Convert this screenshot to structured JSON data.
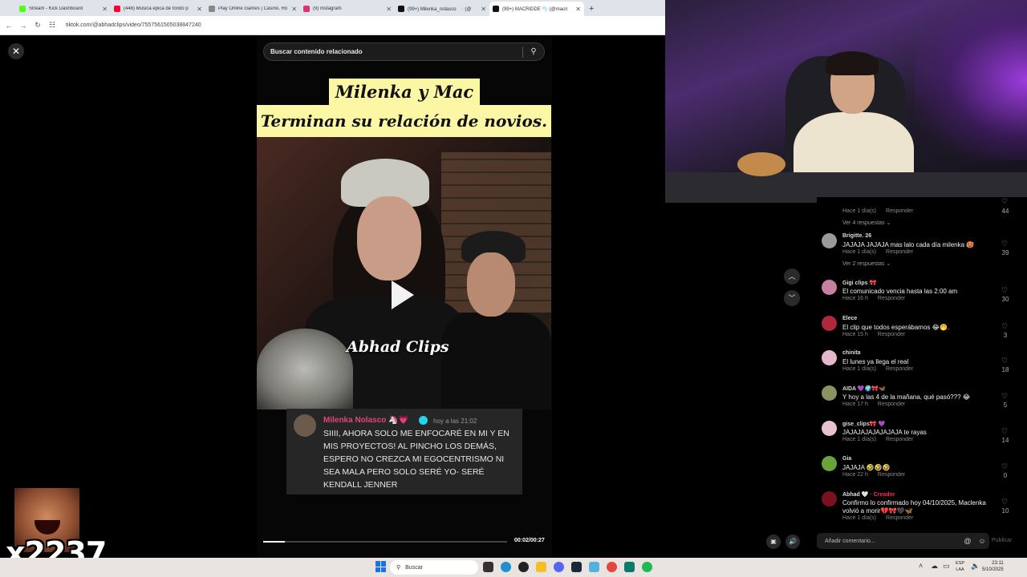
{
  "browser": {
    "tabs": [
      {
        "title": "Stream - Kick Dashboard",
        "color": "#53fc18"
      },
      {
        "title": "(448) Música epica de fondo p",
        "color": "#ff0033"
      },
      {
        "title": "Play Online Games | Casino, Ro",
        "color": "#888888"
      },
      {
        "title": "(9) Instagram",
        "color": "#e1306c"
      },
      {
        "title": "(99+) Milenka_nolasco 🤍 (@",
        "color": "#111111"
      },
      {
        "title": "(99+) MACRIDDE 🫧 (@macri",
        "color": "#111111"
      }
    ],
    "new_tab": "+",
    "url": "tiktok.com/@abhadclips/video/7557561505038847240"
  },
  "video": {
    "search_placeholder": "Buscar contenido relacionado",
    "title_line1": "Milenka y Mac",
    "title_line2": "Terminan su relación de novios.",
    "watermark": "Abhad Clips",
    "comment_card": {
      "name": "Milenka Nolasco 🦄💗",
      "time": "hoy a las 21:02",
      "text": "SIIII, AHORA SOLO ME ENFOCARÉ EN MI Y EN MIS PROYECTOS! AL PINCHO LOS DEMÁS, ESPERO NO CREZCA MI EGOCENTRISMO NI SEA MALA PERO SOLO SERÉ YO- SERÉ KENDALL JENNER"
    },
    "progress": 0.09,
    "timecode": "00:02/00:27"
  },
  "comments": {
    "items": [
      {
        "user": "",
        "text": "",
        "meta": "Hace 1 día(s)",
        "reply": "Responder",
        "likes": "44",
        "more": "Ver 4 respuestas ⌄",
        "avatar": "#555555"
      },
      {
        "user": "Brigitte. 26",
        "text": "JAJAJA JAJAJA mas lalo cada día milenka 🥵",
        "meta": "Hace 1 día(s)",
        "reply": "Responder",
        "likes": "39",
        "more": "Ver 2 respuestas ⌄",
        "avatar": "#9a9a9a"
      },
      {
        "user": "Gigi clips 🎀",
        "text": "El comunicado vencia hasta las 2:00 am",
        "meta": "Hace 16 h",
        "reply": "Responder",
        "likes": "30",
        "avatar": "#c87fa0"
      },
      {
        "user": "Elece",
        "text": "El clip que todos esperábamos 😂🤭.",
        "meta": "Hace 15 h",
        "reply": "Responder",
        "likes": "3",
        "avatar": "#b0283c"
      },
      {
        "user": "chinita",
        "text": "El lunes ya llega el real",
        "meta": "Hace 1 día(s)",
        "reply": "Responder",
        "likes": "18",
        "avatar": "#e6b7cc"
      },
      {
        "user": "AIDA 💜🌍🎀🦋",
        "text": "Y hoy a las 4 de la mañana, qué pasó??? 😂",
        "meta": "Hace 17 h",
        "reply": "Responder",
        "likes": "5",
        "avatar": "#8b9460"
      },
      {
        "user": "gise_clips🎀 💜",
        "text": "JAJAJAJAJAJAJAJA te rayas",
        "meta": "Hace 1 día(s)",
        "reply": "Responder",
        "likes": "14",
        "avatar": "#e8c3cf"
      },
      {
        "user": "Gia",
        "text": "JAJAJA 🤣🤣🤣",
        "meta": "Hace 22 h",
        "reply": "Responder",
        "likes": "0",
        "avatar": "#6aa33a"
      },
      {
        "user": "Abhad 🤍",
        "creator": "· Creador",
        "text": "Confirmo lo confirmado hoy 04/10/2025, Maclenka volvió a morir💔🎀🖤🦋",
        "meta": "Hace 1 día(s)",
        "reply": "Responder",
        "likes": "10",
        "avatar": "#7a1020"
      }
    ],
    "add_placeholder": "Añadir comentario...",
    "publish": "Publicar"
  },
  "overlay": {
    "counter": "x2237"
  },
  "taskbar": {
    "search": "Buscar",
    "lang1": "ESP",
    "lang2": "LAA",
    "time": "23:11",
    "date": "5/10/2025"
  }
}
